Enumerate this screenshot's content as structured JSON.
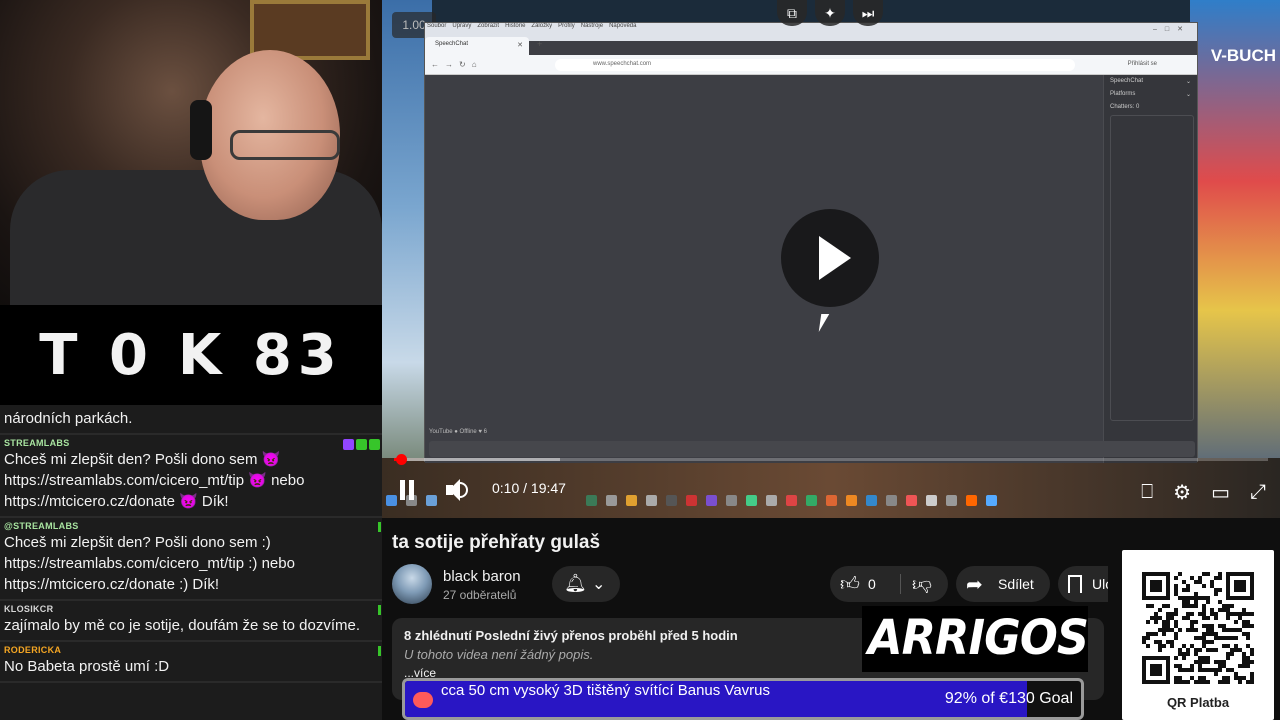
{
  "score": {
    "left_letter": "T",
    "left_value": "0",
    "right_letter": "K",
    "right_value": "83"
  },
  "chat": {
    "messages": [
      {
        "author": "",
        "author_color": "#ffffff",
        "text": "národních parkách."
      },
      {
        "author": "STREAMLABS",
        "author_color": "#a8e4a0",
        "text": "Chceš mi zlepšit den? Pošli dono sem 👿 https://streamlabs.com/cicero_mt/tip 👿 nebo https://mtcicero.cz/donate 👿 Dík!"
      },
      {
        "author": "@STREAMLABS",
        "author_color": "#a8e4a0",
        "text": "Chceš mi zlepšit den? Pošli dono sem :) https://streamlabs.com/cicero_mt/tip :) nebo https://mtcicero.cz/donate :) Dík!"
      },
      {
        "author": "KLOSIKCR",
        "author_color": "#d6d6d6",
        "text": "zajímalo by mě co je sotije, doufám že se to dozvíme."
      },
      {
        "author": "RODERICKA",
        "author_color": "#f5a623",
        "text": "No Babeta prostě umí :D"
      }
    ]
  },
  "player": {
    "speed": "1.00",
    "overlay_text": "V-BUCH",
    "browser": {
      "menu": [
        "Soubor",
        "Úpravy",
        "Zobrazit",
        "Historie",
        "Záložky",
        "Profily",
        "Nástroje",
        "Nápověda"
      ],
      "tab_title": "SpeechChat",
      "url": "www.speechchat.com",
      "signin": "Přihlásit se",
      "sidebar_rows": [
        "SpeechChat",
        "Platforms",
        "Chatters: 0"
      ],
      "status": "YouTube  ● Offline  ♥ 6"
    },
    "time_current": "0:10",
    "time_sep": " / ",
    "time_total": "19:47",
    "played_fraction": 0.0085,
    "loaded_fraction": 0.19,
    "top_icons": [
      "miniplayer-icon",
      "sparkle-icon",
      "autoplay-icon"
    ]
  },
  "video": {
    "title": "ta sotije přehřaty gulaš",
    "channel_name": "black baron",
    "subscribers": "27 odběratelů",
    "like_count": "0",
    "share_label": "Sdílet",
    "save_label": "Ulo",
    "meta": "8 zhlédnutí  Poslední živý přenos proběhl před 5 hodin",
    "no_description": "U tohoto videa není žádný popis.",
    "more": "...více"
  },
  "sponsor": {
    "logo_text": "ARRIGOS"
  },
  "goal": {
    "title": "cca 50 cm vysoký 3D tištěný svítící Banus Vavrus",
    "progress_label": "92% of €130 Goal",
    "fraction": 0.92,
    "bar_color": "#2916c4"
  },
  "qr": {
    "label": "QR Platba"
  }
}
